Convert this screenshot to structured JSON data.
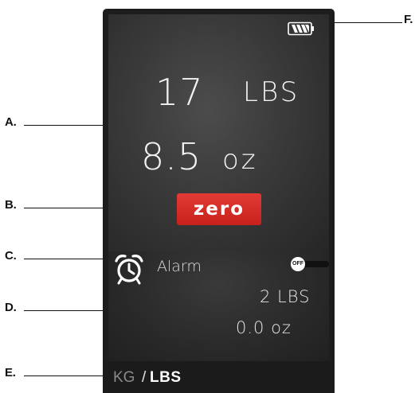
{
  "callouts": {
    "a": "A.",
    "b": "B.",
    "c": "C.",
    "d": "D.",
    "e": "E.",
    "f": "F."
  },
  "display": {
    "main_weight": {
      "major_value": "17",
      "major_unit": "LBS",
      "minor_value": "8.5",
      "minor_unit": "oz"
    },
    "zero_button_label": "zero",
    "battery_icon": "battery-full-icon",
    "alarm": {
      "icon": "alarm-clock-icon",
      "label": "Alarm",
      "toggle_label": "OFF",
      "state": "off",
      "target_major": "2 LBS",
      "target_minor": "0.0 oz"
    },
    "units": {
      "kg": "KG",
      "separator": "/",
      "lbs": "LBS",
      "active": "LBS"
    }
  },
  "colors": {
    "zero_button": "#d62a24",
    "device_body": "#1d1d1d",
    "text_primary": "#f2f2f2",
    "inactive_unit": "#8a8a8a"
  }
}
